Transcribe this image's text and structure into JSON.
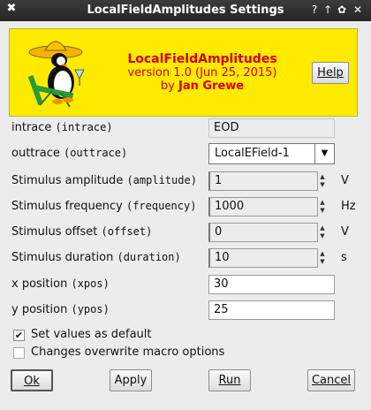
{
  "window": {
    "title": "LocalFieldAmplitudes Settings",
    "icon": "x-icon",
    "controls": [
      "?",
      "↑",
      "✿",
      "✕"
    ]
  },
  "header": {
    "name": "LocalFieldAmplitudes",
    "version": "version 1.0 (Jun 25, 2015)",
    "by": "by",
    "author": "Jan Grewe",
    "help_label": "Help",
    "bg_color": "#ffeb00",
    "text_color": "#d40000"
  },
  "form": {
    "intrace": {
      "label": "intrace",
      "key": "(intrace)",
      "value": "EOD"
    },
    "outtrace": {
      "label": "outtrace",
      "key": "(outtrace)",
      "value": "LocalEField-1"
    },
    "amplitude": {
      "label": "Stimulus amplitude",
      "key": "(amplitude)",
      "value": "1",
      "unit": "V"
    },
    "frequency": {
      "label": "Stimulus frequency",
      "key": "(frequency)",
      "value": "1000",
      "unit": "Hz"
    },
    "offset": {
      "label": "Stimulus offset",
      "key": "(offset)",
      "value": "0",
      "unit": "V"
    },
    "duration": {
      "label": "Stimulus duration",
      "key": "(duration)",
      "value": "10",
      "unit": "s"
    },
    "xpos": {
      "label": "x position",
      "key": "(xpos)",
      "value": "30"
    },
    "ypos": {
      "label": "y position",
      "key": "(ypos)",
      "value": "25"
    }
  },
  "options": {
    "set_default": {
      "label": "Set values as default",
      "checked": true
    },
    "overwrite": {
      "label": "Changes overwrite macro options",
      "checked": false
    }
  },
  "buttons": {
    "ok": "Ok",
    "apply": "Apply",
    "run": "Run",
    "cancel": "Cancel"
  }
}
